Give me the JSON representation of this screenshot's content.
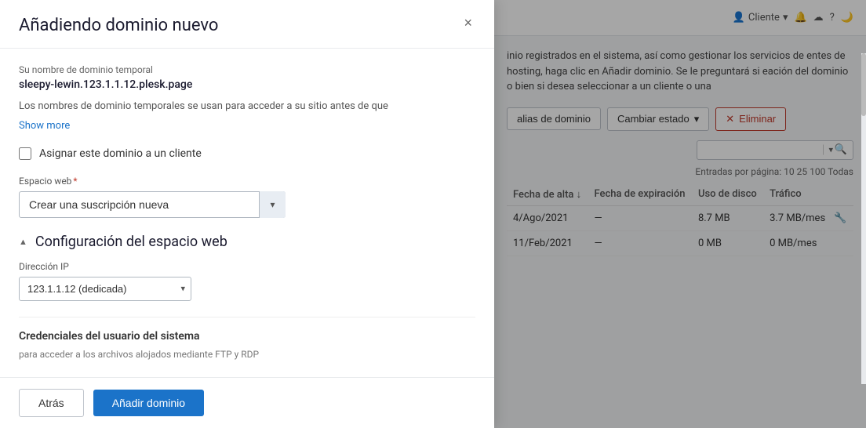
{
  "modal": {
    "title": "Añadiendo dominio nuevo",
    "close_label": "×",
    "temp_domain": {
      "label": "Su nombre de dominio temporal",
      "value": "sleepy-lewin.123.1.1.12.plesk.page",
      "description": "Los nombres de dominio temporales se usan para acceder a su sitio antes de que",
      "show_more": "Show more"
    },
    "assign_checkbox": {
      "label": "Asignar este dominio a un cliente"
    },
    "web_space": {
      "label": "Espacio web",
      "required_marker": "*",
      "selected": "Crear una suscripción nueva",
      "options": [
        "Crear una suscripción nueva"
      ]
    },
    "web_space_config": {
      "section_title": "Configuración del espacio web",
      "collapse_icon": "▲",
      "ip_label": "Dirección IP",
      "ip_selected": "123.1.1.12 (dedicada)",
      "ip_options": [
        "123.1.1.12 (dedicada)"
      ]
    },
    "credentials": {
      "title": "Credenciales del usuario del sistema",
      "description": "para acceder a los archivos alojados mediante FTP y RDP"
    },
    "footer": {
      "back_label": "Atrás",
      "submit_label": "Añadir dominio"
    }
  },
  "background": {
    "topbar": {
      "client_label": "Cliente",
      "icons": [
        "notification-icon",
        "cloud-icon",
        "help-icon",
        "user-icon"
      ]
    },
    "description": "inio registrados en el sistema, así como gestionar los servicios de entes de hosting, haga clic en Añadir dominio. Se le preguntará si eación del dominio o bien si desea seleccionar a un cliente o una",
    "toolbar": {
      "aliases": "alias de dominio",
      "change_state": "Cambiar estado",
      "delete": "Eliminar"
    },
    "pagination": "Entradas por página: 10 25 100 Todas",
    "table": {
      "headers": [
        "Fecha de alta ↓",
        "Fecha de expiración",
        "Uso de disco",
        "Tráfico"
      ],
      "rows": [
        {
          "date_alta": "4/Ago/2021",
          "fecha_exp": "—",
          "uso_disco": "8.7 MB",
          "trafico": "3.7 MB/mes",
          "has_icon": true
        },
        {
          "date_alta": "11/Feb/2021",
          "fecha_exp": "—",
          "uso_disco": "0 MB",
          "trafico": "0 MB/mes",
          "has_icon": false
        }
      ]
    }
  }
}
